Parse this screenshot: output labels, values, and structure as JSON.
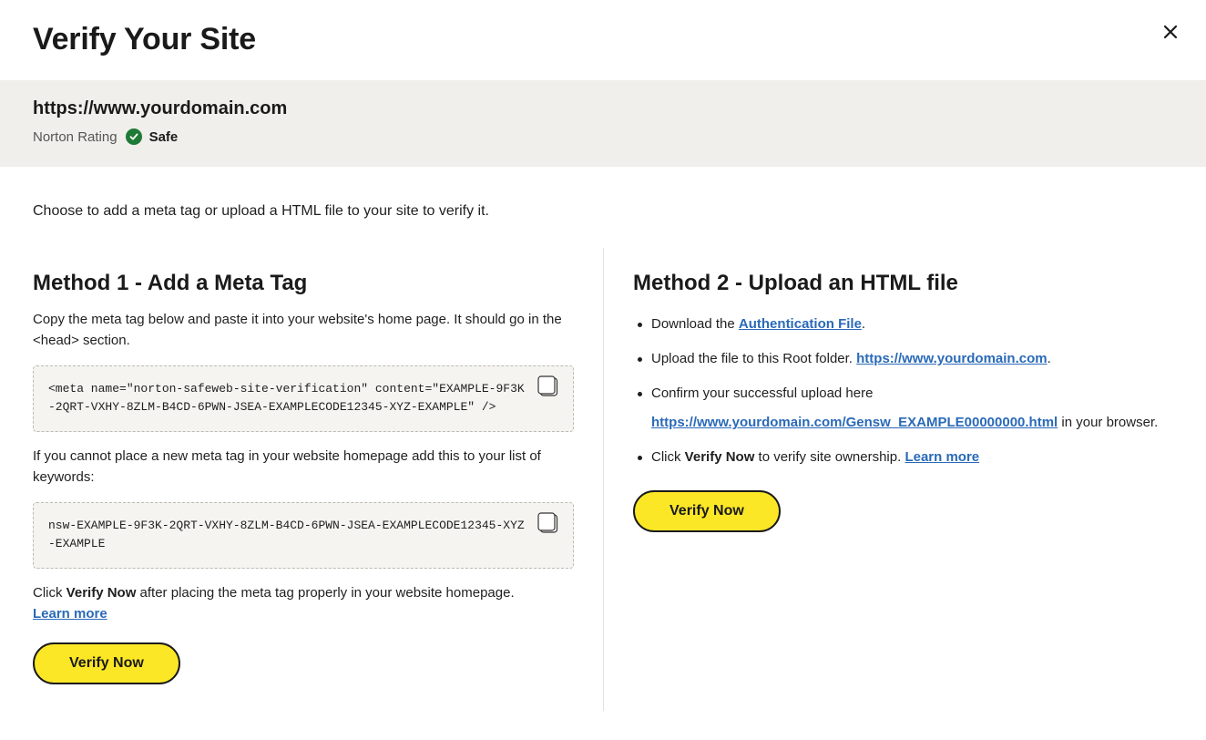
{
  "dialog": {
    "title": "Verify Your Site",
    "close_icon": "close-icon"
  },
  "site": {
    "url": "https://www.yourdomain.com",
    "rating_label": "Norton Rating",
    "rating_value": "Safe",
    "rating_color": "#1f7a35"
  },
  "intro": "Choose to add a meta tag or upload a HTML file to your site to verify it.",
  "method1": {
    "title": "Method 1 - Add a Meta Tag",
    "instructions": "Copy the meta tag below and paste it into your website's home page. It should go in the <head> section.",
    "meta_tag": "<meta name=\"norton-safeweb-site-verification\" content=\"EXAMPLE-9F3K-2QRT-VXHY-8ZLM-B4CD-6PWN-JSEA-EXAMPLECODE12345-XYZ-EXAMPLE\" />",
    "keywords_instructions": "If you cannot place a new meta tag in your website homepage add this to your list of keywords:",
    "keyword": "nsw-EXAMPLE-9F3K-2QRT-VXHY-8ZLM-B4CD-6PWN-JSEA-EXAMPLECODE12345-XYZ-EXAMPLE",
    "final_prefix": "Click ",
    "final_bold": "Verify Now",
    "final_suffix": " after placing the meta tag properly in your website homepage.",
    "learn_more": "Learn more",
    "verify_label": "Verify Now"
  },
  "method2": {
    "title": "Method 2 - Upload an HTML file",
    "step1_prefix": "Download the ",
    "step1_link": "Authentication File",
    "step1_suffix": ".",
    "step2_prefix": "Upload the file to this Root folder. ",
    "step2_link": "https://www.yourdomain.com",
    "step2_suffix": ".",
    "step3_prefix": "Confirm your successful upload here",
    "step3_link": "https://www.yourdomain.com/Gensw_EXAMPLE00000000.html",
    "step3_suffix": " in your browser.",
    "step4_prefix": "Click ",
    "step4_bold": "Verify Now",
    "step4_middle": " to verify site ownership. ",
    "step4_link": "Learn more",
    "verify_label": "Verify Now"
  },
  "colors": {
    "accent_button": "#fce727",
    "link": "#2a6ab8",
    "band_background": "#f0efeb"
  }
}
